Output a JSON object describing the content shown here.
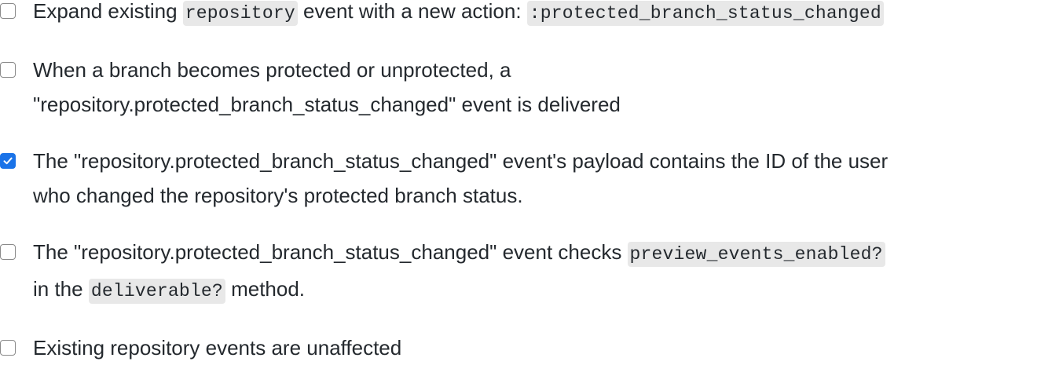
{
  "task_list": {
    "items": [
      {
        "checked": false,
        "text_a": "Expand existing ",
        "code_a": "repository",
        "text_b": " event with a new action: ",
        "code_b": ":protected_branch_status_changed"
      },
      {
        "checked": false,
        "line_1": "When a branch becomes protected or unprotected, a",
        "line_2": "\"repository.protected_branch_status_changed\" event is delivered"
      },
      {
        "checked": true,
        "line_1": "The \"repository.protected_branch_status_changed\" event's payload contains the ID of the user",
        "line_2": "who changed the repository's protected branch status."
      },
      {
        "checked": false,
        "text_a": "The \"repository.protected_branch_status_changed\" event checks ",
        "code_a": "preview_events_enabled?",
        "text_b": "in the ",
        "code_b": "deliverable?",
        "text_c": " method."
      },
      {
        "checked": false,
        "text": "Existing repository events are unaffected"
      }
    ]
  }
}
